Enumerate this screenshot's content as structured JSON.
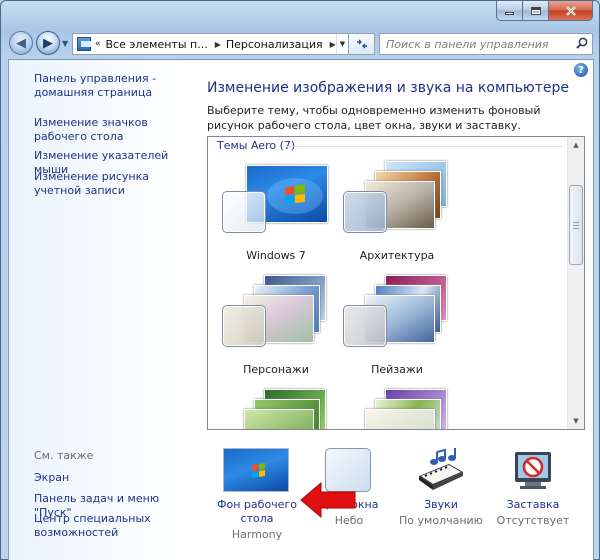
{
  "window": {
    "caption_buttons": [
      "minimize",
      "maximize",
      "close"
    ]
  },
  "nav": {
    "breadcrumb": [
      "Все элементы п...",
      "Персонализация"
    ],
    "search_placeholder": "Поиск в панели управления"
  },
  "sidebar": {
    "links": [
      "Панель управления - домашняя страница",
      "Изменение значков рабочего стола",
      "Изменение указателей мыши",
      "Изменение рисунка учетной записи"
    ],
    "see_also_heading": "См. также",
    "see_also": [
      "Экран",
      "Панель задач и меню \"Пуск\"",
      "Центр специальных возможностей"
    ]
  },
  "main": {
    "title": "Изменение изображения и звука на компьютере",
    "description": "Выберите тему, чтобы одновременно изменить фоновый рисунок рабочего стола, цвет окна, звуки и заставку.",
    "group_label": "Темы Aero (7)",
    "themes": [
      "Windows 7",
      "Архитектура",
      "Персонажи",
      "Пейзажи"
    ]
  },
  "bottom": {
    "background": {
      "label": "Фон рабочего стола",
      "value": "Harmony"
    },
    "color": {
      "label": "Цвет окна",
      "value": "Небо"
    },
    "sounds": {
      "label": "Звуки",
      "value": "По умолчанию"
    },
    "screensaver": {
      "label": "Заставка",
      "value": "Отсутствует"
    }
  },
  "colors": {
    "link": "#1e3287",
    "arrow": "#e01010",
    "win7_blue": "#1a69c9"
  }
}
